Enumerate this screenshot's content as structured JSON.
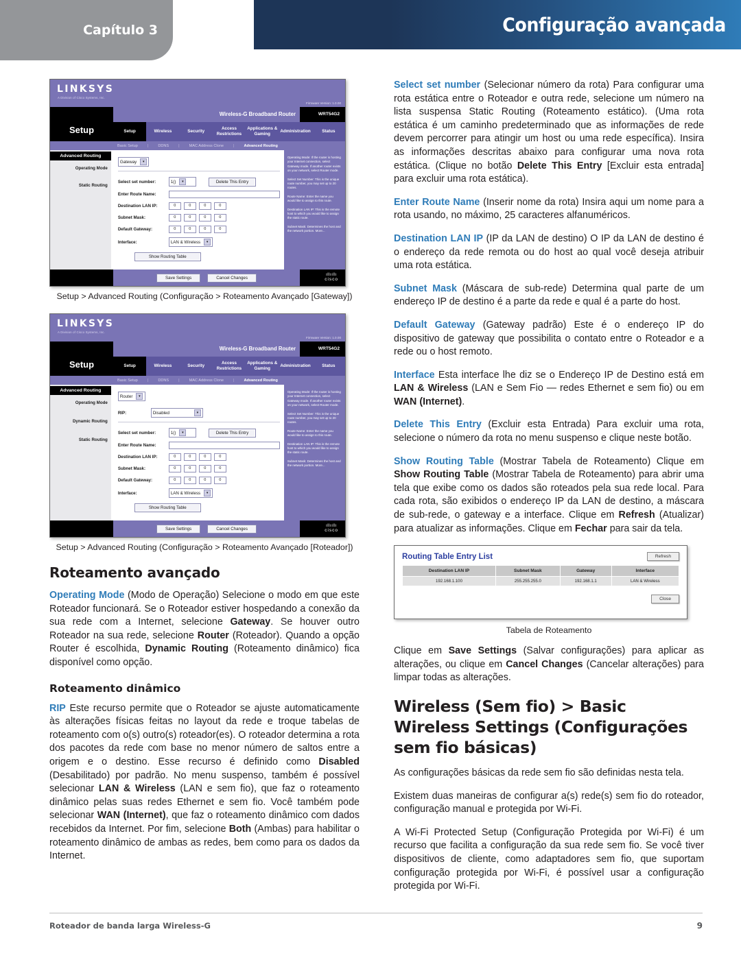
{
  "header": {
    "chapter_label": "Capítulo 3",
    "title": "Configuração avançada"
  },
  "footer": {
    "doc_title": "Roteador de banda larga Wireless-G",
    "page_number": "9"
  },
  "screenshots": [
    {
      "logo": "LINKSYS",
      "logo_sub": "A Division of Cisco Systems, Inc.",
      "firmware": "Firmware Version: 1.0.00",
      "product_name": "Wireless-G Broadband Router",
      "model": "WRT54G2",
      "section_title": "Setup",
      "tabs": [
        "Setup",
        "Wireless",
        "Security",
        "Access Restrictions",
        "Applications & Gaming",
        "Administration",
        "Status"
      ],
      "subnav": [
        "Basic Setup",
        "DDNS",
        "MAC Address Clone",
        "Advanced Routing"
      ],
      "subnav_selected": "Advanced Routing",
      "side_header": "Advanced Routing",
      "side_labels": [
        "Operating Mode",
        "Static Routing"
      ],
      "operating_mode_value": "Gateway",
      "fields": {
        "select_set_number_label": "Select set number:",
        "select_set_number_value": "1()",
        "delete_button": "Delete This Entry",
        "route_name_label": "Enter Route Name:",
        "route_name_value": "",
        "destination_lan_ip_label": "Destination LAN IP:",
        "subnet_mask_label": "Subnet Mask:",
        "default_gateway_label": "Default Gateway:",
        "interface_label": "Interface:",
        "interface_value": "LAN & Wireless",
        "octets": [
          "0",
          "0",
          "0",
          "0"
        ],
        "show_routing_table_button": "Show Routing Table"
      },
      "help": [
        "Operating Mode: If the router is hosting your Internet connection, select Gateway mode. If another router exists on your network, select Router mode.",
        "Select Set Number: This is the unique route number, you may set up to 20 routes.",
        "Route Name: Enter the name you would like to assign to this route.",
        "Destination LAN IP: This is the remote host to which you would like to assign the static route.",
        "Subnet Mask: Determines the host and the network portion. More..."
      ],
      "footer_buttons": [
        "Save Settings",
        "Cancel Changes"
      ],
      "brand_footer": "cisco",
      "caption": "Setup > Advanced Routing (Configuração > Roteamento Avançado [Gateway])"
    },
    {
      "logo": "LINKSYS",
      "logo_sub": "A Division of Cisco Systems, Inc.",
      "firmware": "Firmware Version: 1.0.00",
      "product_name": "Wireless-G Broadband Router",
      "model": "WRT54G2",
      "section_title": "Setup",
      "tabs": [
        "Setup",
        "Wireless",
        "Security",
        "Access Restrictions",
        "Applications & Gaming",
        "Administration",
        "Status"
      ],
      "subnav": [
        "Basic Setup",
        "DDNS",
        "MAC Address Clone",
        "Advanced Routing"
      ],
      "subnav_selected": "Advanced Routing",
      "side_header": "Advanced Routing",
      "side_labels": [
        "Operating Mode",
        "Dynamic Routing",
        "Static Routing"
      ],
      "operating_mode_value": "Router",
      "fields": {
        "rip_label": "RIP:",
        "rip_value": "Disabled",
        "select_set_number_label": "Select set number:",
        "select_set_number_value": "1()",
        "delete_button": "Delete This Entry",
        "route_name_label": "Enter Route Name:",
        "route_name_value": "",
        "destination_lan_ip_label": "Destination LAN IP:",
        "subnet_mask_label": "Subnet Mask:",
        "default_gateway_label": "Default Gateway:",
        "interface_label": "Interface:",
        "interface_value": "LAN & Wireless",
        "octets": [
          "0",
          "0",
          "0",
          "0"
        ],
        "show_routing_table_button": "Show Routing Table"
      },
      "help": [
        "Operating Mode: If the router is hosting your Internet connection, select Gateway mode. If another router exists on your network, select Router mode.",
        "Select Set Number: This is the unique route number, you may set up to 20 routes.",
        "Route Name: Enter the name you would like to assign to this route.",
        "Destination LAN IP: This is the remote host to which you would like to assign the static route.",
        "Subnet Mask: Determines the host and the network portion. More..."
      ],
      "footer_buttons": [
        "Save Settings",
        "Cancel Changes"
      ],
      "brand_footer": "cisco",
      "caption": "Setup > Advanced Routing (Configuração > Roteamento Avançado [Roteador])"
    }
  ],
  "left_column": {
    "heading_advanced_routing": "Roteamento avançado",
    "operating_mode": {
      "term": "Operating Mode",
      "body_1": " (Modo de Operação) Selecione o modo em que este Roteador funcionará. Se o Roteador estiver hospedando a conexão da sua rede com a Internet, selecione ",
      "bold_1": "Gateway",
      "body_2": ". Se houver outro Roteador na sua rede, selecione ",
      "bold_2": "Router",
      "body_3": " (Roteador). Quando a opção Router é escolhida, ",
      "bold_3": "Dynamic Routing",
      "body_4": " (Roteamento dinâmico) fica disponível como opção."
    },
    "heading_dynamic_routing": "Roteamento dinâmico",
    "rip": {
      "term": "RIP",
      "body_1": " Este recurso permite que o Roteador se ajuste automaticamente às alterações físicas feitas no layout da rede e troque tabelas de roteamento com o(s) outro(s) roteador(es). O roteador determina a rota dos pacotes da rede com base no menor número de saltos entre a origem e o destino. Esse recurso é definido como ",
      "bold_1": "Disabled",
      "body_2": " (Desabilitado) por padrão. No menu suspenso, também é possível selecionar ",
      "bold_2": "LAN & Wireless",
      "body_3": " (LAN e sem fio), que faz o roteamento dinâmico pelas suas redes Ethernet e sem fio. Você também pode selecionar ",
      "bold_3": "WAN (Internet)",
      "body_4": ", que faz o roteamento dinâmico com dados recebidos da Internet. Por fim, selecione ",
      "bold_4": "Both",
      "body_5": " (Ambas) para habilitar o roteamento dinâmico de ambas as redes, bem como para os dados da Internet."
    }
  },
  "right_column": {
    "select_set_number": {
      "term": "Select set number",
      "body_1": " (Selecionar número da rota) Para configurar uma rota estática entre o Roteador e outra rede, selecione um número na lista suspensa Static Routing (Roteamento estático). (Uma rota estática é um caminho predeterminado que as informações de rede devem percorrer para atingir um host ou uma rede específica). Insira as informações descritas abaixo para configurar uma nova rota estática. (Clique no botão ",
      "bold_1": "Delete This Entry",
      "body_2": " [Excluir esta entrada] para excluir uma rota estática)."
    },
    "enter_route_name": {
      "term": "Enter Route Name",
      "body_1": " (Inserir nome da rota) Insira aqui um nome para a rota usando, no máximo, 25 caracteres alfanuméricos."
    },
    "destination_lan_ip": {
      "term": "Destination LAN IP",
      "body_1": "  (IP da LAN de destino) O IP da LAN de destino é o endereço da rede remota ou do host ao qual você deseja atribuir uma rota estática."
    },
    "subnet_mask": {
      "term": "Subnet Mask",
      "body_1": "  (Máscara de sub-rede) Determina qual parte de um endereço IP de destino é a parte da rede e qual é a parte do host."
    },
    "default_gateway": {
      "term": "Default Gateway",
      "body_1": "  (Gateway padrão) Este é o endereço IP do dispositivo de gateway que possibilita o contato entre o Roteador e a rede ou o host remoto."
    },
    "interface": {
      "term": "Interface",
      "body_1": "  Esta interface lhe diz se o Endereço IP de Destino está em ",
      "bold_1": "LAN & Wireless",
      "body_2": " (LAN e Sem Fio — redes Ethernet e sem fio) ou em ",
      "bold_2": "WAN (Internet)",
      "body_3": "."
    },
    "delete_this_entry": {
      "term": "Delete This Entry",
      "body_1": " (Excluir esta Entrada) Para excluir uma rota, selecione o número da rota no menu suspenso e clique neste botão."
    },
    "show_routing_table": {
      "term": "Show Routing Table",
      "body_1": "  (Mostrar Tabela de Roteamento) Clique em ",
      "bold_1": "Show Routing Table",
      "body_2": " (Mostrar Tabela de Roteamento) para abrir uma tela que exibe como os dados são roteados pela sua rede local. Para cada rota, são exibidos o endereço IP da LAN de destino, a máscara de sub-rede, o gateway e a interface. Clique em ",
      "bold_2": "Refresh",
      "body_3": " (Atualizar) para atualizar as informações. Clique em ",
      "bold_3": "Fechar",
      "body_4": " para sair da tela."
    },
    "save_settings_para": {
      "body_1": "Clique em ",
      "bold_1": "Save Settings",
      "body_2": " (Salvar configurações) para aplicar as alterações, ou clique em ",
      "bold_2": "Cancel Changes",
      "body_3": " (Cancelar alterações) para limpar todas as alterações."
    },
    "wireless_heading": "Wireless (Sem fio) > Basic Wireless Settings (Configurações sem fio básicas)",
    "wireless_p1": "As configurações básicas da rede sem fio são definidas nesta tela.",
    "wireless_p2": "Existem duas maneiras de configurar a(s) rede(s) sem fio do roteador, configuração manual e protegida por Wi-Fi.",
    "wireless_p3": "A Wi-Fi Protected Setup (Configuração Protegida por Wi-Fi) é um recurso que facilita a configuração da sua rede sem fio. Se você tiver dispositivos de cliente, como adaptadores sem fio, que suportam configuração protegida por Wi-Fi, é possível usar a configuração protegida por Wi-Fi."
  },
  "routing_table_figure": {
    "title": "Routing Table Entry List",
    "refresh_button": "Refresh",
    "close_button": "Close",
    "columns": [
      "Destination LAN IP",
      "Subnet Mask",
      "Gateway",
      "Interface"
    ],
    "rows": [
      [
        "192.168.1.100",
        "255.255.255.0",
        "192.168.1.1",
        "LAN & Wireless"
      ]
    ],
    "caption": "Tabela de Roteamento"
  },
  "colors": {
    "accent_blue": "#2f7cb8",
    "header_dark": "#1d3557",
    "chapter_gray": "#949699",
    "router_purple": "#7a74b5",
    "table_title_blue": "#2d3fa0"
  }
}
